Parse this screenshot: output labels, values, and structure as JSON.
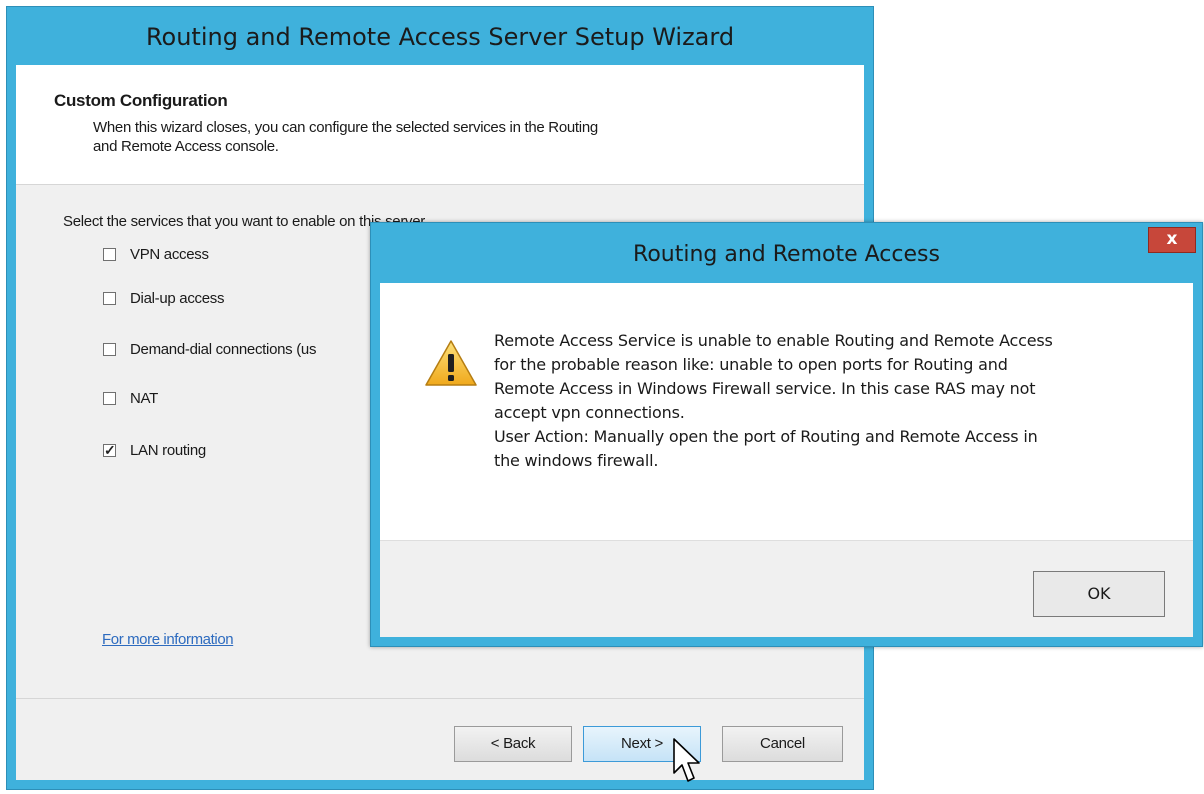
{
  "wizard": {
    "title": "Routing and Remote Access Server Setup Wizard",
    "header_title": "Custom Configuration",
    "header_desc_line1": "When this wizard closes, you can configure the selected services in the Routing",
    "header_desc_line2": "and Remote Access console.",
    "prompt": "Select the services that you want to enable on this server.",
    "services": [
      {
        "label": "VPN access",
        "checked": false
      },
      {
        "label": "Dial-up access",
        "checked": false
      },
      {
        "label": "Demand-dial connections (us",
        "checked": false
      },
      {
        "label": "NAT",
        "checked": false
      },
      {
        "label": "LAN routing",
        "checked": true
      }
    ],
    "more_info_link": "For more information",
    "back_label": "< Back",
    "next_label": "Next >",
    "cancel_label": "Cancel"
  },
  "dialog": {
    "title": "Routing and Remote Access",
    "close_label": "x",
    "message_lines": [
      "Remote Access Service is unable to enable Routing and Remote Access",
      "for the probable reason like:  unable to open ports for Routing and",
      "Remote Access in Windows Firewall service. In this case RAS may not",
      "accept vpn connections.",
      "User Action: Manually open the port of Routing and Remote Access in",
      "the windows firewall."
    ],
    "ok_label": "OK",
    "icon": "warning-icon"
  },
  "colors": {
    "frame": "#3fb1dc",
    "close_button": "#c7473a",
    "link": "#2d6bbf"
  }
}
